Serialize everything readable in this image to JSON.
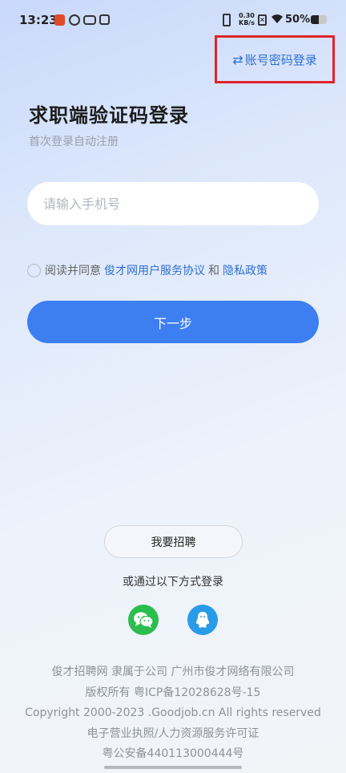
{
  "status": {
    "time": "13:23",
    "net_speed_value": "0.30",
    "net_speed_unit": "KB/s",
    "battery": "50%"
  },
  "icons": {
    "switch": "swap-arrows-icon",
    "wechat": "wechat-icon",
    "qq": "qq-icon"
  },
  "colors": {
    "accent": "#3d7ef0",
    "link": "#2f6fd1",
    "highlight_box": "#e0242a",
    "wechat": "#2bbd4e",
    "qq": "#2a9be8"
  },
  "header": {
    "switch_login_label": "账号密码登录"
  },
  "login": {
    "title": "求职端验证码登录",
    "subtitle": "首次登录自动注册",
    "phone_placeholder": "请输入手机号",
    "agree_prefix": "阅读并同意",
    "agreement_link": "俊才网用户服务协议",
    "agree_and": "和",
    "privacy_link": "隐私政策",
    "next_label": "下一步"
  },
  "alt": {
    "recruit_label": "我要招聘",
    "other_login_label": "或通过以下方式登录"
  },
  "footer": {
    "line1": "俊才招聘网 隶属于公司 广州市俊才网络有限公司",
    "line2": "版权所有 粤ICP备12028628号-15",
    "line3": "Copyright 2000-2023 .Goodjob.cn All rights reserved",
    "line4": "电子营业执照/人力资源服务许可证",
    "line5": "粤公安备440113000444号"
  }
}
